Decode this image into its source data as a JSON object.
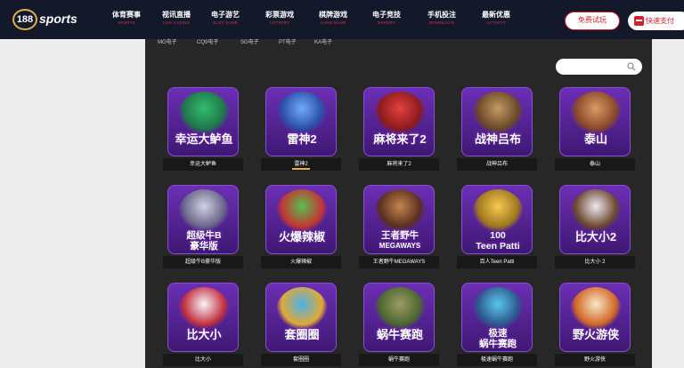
{
  "brand": {
    "logo_number": "188",
    "logo_word": "sports"
  },
  "nav": [
    {
      "cn": "体育赛事",
      "en": "SPORTS"
    },
    {
      "cn": "视讯直播",
      "en": "LIVE CASINO"
    },
    {
      "cn": "电子游艺",
      "en": "SLOT GAME"
    },
    {
      "cn": "彩票游戏",
      "en": "LOTTERY"
    },
    {
      "cn": "棋牌游戏",
      "en": "CARD GAME"
    },
    {
      "cn": "电子竞技",
      "en": "ESPORT"
    },
    {
      "cn": "手机投注",
      "en": "DOWNLOAD"
    },
    {
      "cn": "最新优惠",
      "en": "ACTIVITY"
    }
  ],
  "buttons": {
    "trial": "免费试玩",
    "pay": "快速支付"
  },
  "subtabs": [
    "MG电子",
    "CQ9电子",
    "SG电子",
    "PT电子",
    "KA电子"
  ],
  "search": {
    "placeholder": ""
  },
  "games": [
    {
      "title": "幸运大鲈鱼",
      "caption": "幸运大鲈鱼",
      "icon": "fish-fisherman-art"
    },
    {
      "title": "雷神2",
      "caption": "雷神2",
      "icon": "thunder-god-art"
    },
    {
      "title": "麻将来了2",
      "caption": "麻将来了2",
      "icon": "mahjong-tile-art"
    },
    {
      "title": "战神吕布",
      "caption": "战神吕布",
      "icon": "warrior-art"
    },
    {
      "title": "泰山",
      "caption": "泰山",
      "icon": "tarzan-art"
    },
    {
      "title": "超级牛B",
      "caption": "超级牛B豪华版",
      "icon": "slot-reels-art"
    },
    {
      "title": "火爆辣椒",
      "caption": "火爆辣椒",
      "icon": "chili-peppers-art"
    },
    {
      "title": "王者野牛",
      "caption": "王者野牛MEGAWAYS",
      "icon": "bison-art"
    },
    {
      "title": "100",
      "caption": "百人Teen Patti",
      "icon": "playing-cards-art"
    },
    {
      "title": "比大小2",
      "caption": "比大小 2",
      "icon": "dice-cup-art"
    },
    {
      "title": "比大小",
      "caption": "比大小",
      "icon": "dice-art"
    },
    {
      "title": "套圈圈",
      "caption": "套圈圈",
      "icon": "ring-toss-art"
    },
    {
      "title": "蜗牛赛跑",
      "caption": "蜗牛赛跑",
      "icon": "snail-race-art"
    },
    {
      "title": "极速",
      "caption": "极速蜗牛赛跑",
      "icon": "fast-snail-art"
    },
    {
      "title": "野火游侠",
      "caption": "野火游侠",
      "icon": "flaming-skull-art"
    }
  ],
  "game_subtitles": {
    "g6": "豪华版",
    "g8": "MEGAWAYS",
    "g9": "Teen Patti",
    "g14": "蜗牛赛跑"
  },
  "colors": {
    "header_bg": "#13182b",
    "accent_red": "#d2212c",
    "gold": "#e0b14a",
    "panel_bg": "#272727",
    "tile_purple": "#6c2fb4"
  }
}
